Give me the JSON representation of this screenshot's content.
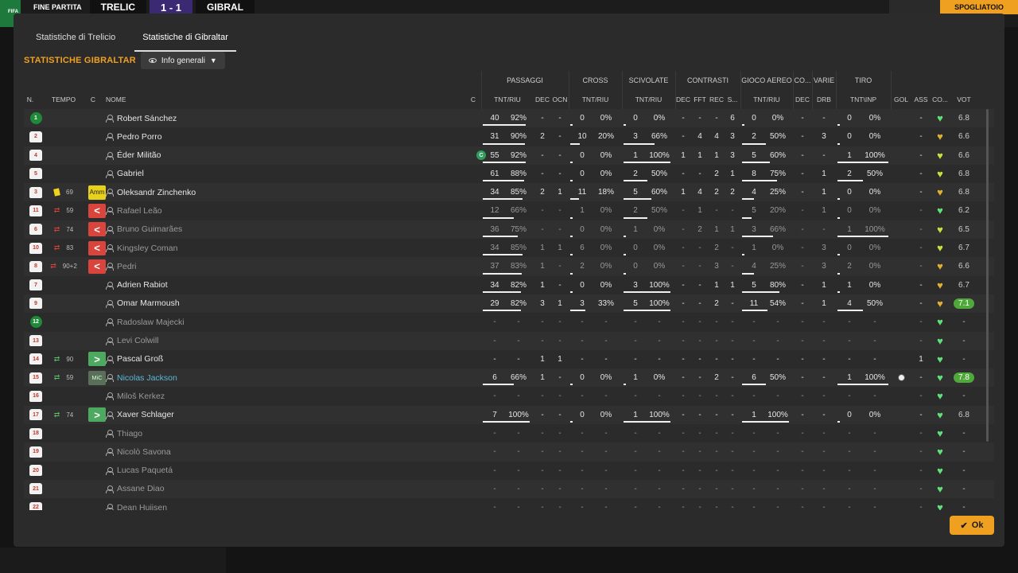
{
  "background": {
    "fifa_label": "FIFA",
    "match_status": "FINE PARTITA",
    "team_home": "TRELIC",
    "score": "1 - 1",
    "team_away": "GIBRAL",
    "right_button": "SPOGLIATOIO"
  },
  "tabs": [
    "Statistiche di Trelicio",
    "Statistiche di Gibraltar"
  ],
  "title": "STATISTICHE GIBRALTAR",
  "dropdown_label": "Info generali",
  "group_headers": {
    "passaggi": "PASSAGGI",
    "cross": "CROSS",
    "scivolate": "SCIVOLATE",
    "contrasti": "CONTRASTI",
    "gioco_aereo": "GIOCO AEREO",
    "co": "CO...",
    "varie": "VARIE",
    "tiro": "TIRO"
  },
  "column_headers": {
    "n": "N.",
    "tempo": "TEMPO",
    "c": "C",
    "nome": "NOME",
    "c2": "C",
    "pass_tnt": "TNT/RIU",
    "pass_dec": "DEC",
    "pass_ocn": "OCN",
    "cross_tnt": "TNT/RIU",
    "sciv_tnt": "TNT/RIU",
    "con_dec": "DEC",
    "con_fft": "FFT",
    "con_rec": "REC",
    "con_s": "S...",
    "aer_tnt": "TNT/RIU",
    "co_dec": "DEC",
    "var_drb": "DRB",
    "tiro_tnt": "TNT\\INP",
    "gol": "GOL",
    "ass": "ASS",
    "co2": "CO...",
    "vot": "VOT"
  },
  "rows": [
    {
      "num": "1",
      "gk": true,
      "minute": "",
      "event": "",
      "badge": "",
      "name": "Robert Sánchez",
      "dim": false,
      "captain": false,
      "pass": [
        "40",
        "92%"
      ],
      "pass_fill": 0.92,
      "pdec": "-",
      "pocn": "-",
      "cross": [
        "0",
        "0%"
      ],
      "cross_fill": 0,
      "sciv": [
        "0",
        "0%"
      ],
      "sciv_fill": 0,
      "cdec": "-",
      "cfft": "-",
      "crec": "-",
      "cs": "6",
      "aer": [
        "0",
        "0%"
      ],
      "aer_fill": 0,
      "codec": "-",
      "drb": "-",
      "tiro": [
        "0",
        "0%"
      ],
      "tiro_fill": 0,
      "gol": "",
      "ass": "-",
      "heart": "green",
      "vot": "6.8",
      "vot_hl": false
    },
    {
      "num": "2",
      "gk": false,
      "minute": "",
      "event": "",
      "badge": "",
      "name": "Pedro Porro",
      "dim": false,
      "captain": false,
      "pass": [
        "31",
        "90%"
      ],
      "pass_fill": 0.9,
      "pdec": "2",
      "pocn": "-",
      "cross": [
        "10",
        "20%"
      ],
      "cross_fill": 0.2,
      "sciv": [
        "3",
        "66%"
      ],
      "sciv_fill": 0.66,
      "cdec": "-",
      "cfft": "4",
      "crec": "4",
      "cs": "3",
      "aer": [
        "2",
        "50%"
      ],
      "aer_fill": 0.5,
      "codec": "-",
      "drb": "3",
      "tiro": [
        "0",
        "0%"
      ],
      "tiro_fill": 0,
      "gol": "",
      "ass": "-",
      "heart": "gold",
      "vot": "6.6",
      "vot_hl": false
    },
    {
      "num": "4",
      "gk": false,
      "minute": "",
      "event": "",
      "badge": "",
      "name": "Éder Militão",
      "dim": false,
      "captain": true,
      "pass": [
        "55",
        "92%"
      ],
      "pass_fill": 0.92,
      "pdec": "-",
      "pocn": "-",
      "cross": [
        "0",
        "0%"
      ],
      "cross_fill": 0,
      "sciv": [
        "1",
        "100%"
      ],
      "sciv_fill": 1,
      "cdec": "1",
      "cfft": "1",
      "crec": "1",
      "cs": "3",
      "aer": [
        "5",
        "60%"
      ],
      "aer_fill": 0.6,
      "codec": "-",
      "drb": "-",
      "tiro": [
        "1",
        "100%"
      ],
      "tiro_fill": 1,
      "gol": "",
      "ass": "-",
      "heart": "lime",
      "vot": "6.6",
      "vot_hl": false
    },
    {
      "num": "5",
      "gk": false,
      "minute": "",
      "event": "",
      "badge": "",
      "name": "Gabriel",
      "dim": false,
      "captain": false,
      "pass": [
        "61",
        "88%"
      ],
      "pass_fill": 0.88,
      "pdec": "-",
      "pocn": "-",
      "cross": [
        "0",
        "0%"
      ],
      "cross_fill": 0,
      "sciv": [
        "2",
        "50%"
      ],
      "sciv_fill": 0.5,
      "cdec": "-",
      "cfft": "-",
      "crec": "2",
      "cs": "1",
      "aer": [
        "8",
        "75%"
      ],
      "aer_fill": 0.75,
      "codec": "-",
      "drb": "1",
      "tiro": [
        "2",
        "50%"
      ],
      "tiro_fill": 0.5,
      "gol": "",
      "ass": "-",
      "heart": "lime",
      "vot": "6.8",
      "vot_hl": false
    },
    {
      "num": "3",
      "gk": false,
      "minute": "69",
      "event": "yellow",
      "badge": "Amm",
      "name": "Oleksandr Zinchenko",
      "dim": false,
      "captain": false,
      "pass": [
        "34",
        "85%"
      ],
      "pass_fill": 0.85,
      "pdec": "2",
      "pocn": "1",
      "cross": [
        "11",
        "18%"
      ],
      "cross_fill": 0.18,
      "sciv": [
        "5",
        "60%"
      ],
      "sciv_fill": 0.6,
      "cdec": "1",
      "cfft": "4",
      "crec": "2",
      "cs": "2",
      "aer": [
        "4",
        "25%"
      ],
      "aer_fill": 0.25,
      "codec": "-",
      "drb": "1",
      "tiro": [
        "0",
        "0%"
      ],
      "tiro_fill": 0,
      "gol": "",
      "ass": "-",
      "heart": "gold",
      "vot": "6.8",
      "vot_hl": false
    },
    {
      "num": "11",
      "gk": false,
      "minute": "59",
      "event": "out",
      "badge": "<",
      "name": "Rafael Leão",
      "dim": true,
      "captain": false,
      "pass": [
        "12",
        "66%"
      ],
      "pass_fill": 0.66,
      "pdec": "-",
      "pocn": "-",
      "cross": [
        "1",
        "0%"
      ],
      "cross_fill": 0,
      "sciv": [
        "2",
        "50%"
      ],
      "sciv_fill": 0.5,
      "cdec": "-",
      "cfft": "1",
      "crec": "-",
      "cs": "-",
      "aer": [
        "5",
        "20%"
      ],
      "aer_fill": 0.2,
      "codec": "-",
      "drb": "1",
      "tiro": [
        "0",
        "0%"
      ],
      "tiro_fill": 0,
      "gol": "",
      "ass": "-",
      "heart": "green",
      "vot": "6.2",
      "vot_hl": false
    },
    {
      "num": "6",
      "gk": false,
      "minute": "74",
      "event": "out",
      "badge": "<",
      "name": "Bruno Guimarães",
      "dim": true,
      "captain": false,
      "pass": [
        "36",
        "75%"
      ],
      "pass_fill": 0.75,
      "pdec": "-",
      "pocn": "-",
      "cross": [
        "0",
        "0%"
      ],
      "cross_fill": 0,
      "sciv": [
        "1",
        "0%"
      ],
      "sciv_fill": 0,
      "cdec": "-",
      "cfft": "2",
      "crec": "1",
      "cs": "1",
      "aer": [
        "3",
        "66%"
      ],
      "aer_fill": 0.66,
      "codec": "-",
      "drb": "-",
      "tiro": [
        "1",
        "100%"
      ],
      "tiro_fill": 1,
      "gol": "",
      "ass": "-",
      "heart": "lime",
      "vot": "6.5",
      "vot_hl": false
    },
    {
      "num": "10",
      "gk": false,
      "minute": "83",
      "event": "out",
      "badge": "<",
      "name": "Kingsley Coman",
      "dim": true,
      "captain": false,
      "pass": [
        "34",
        "85%"
      ],
      "pass_fill": 0.85,
      "pdec": "1",
      "pocn": "1",
      "cross": [
        "6",
        "0%"
      ],
      "cross_fill": 0,
      "sciv": [
        "0",
        "0%"
      ],
      "sciv_fill": 0,
      "cdec": "-",
      "cfft": "-",
      "crec": "2",
      "cs": "-",
      "aer": [
        "1",
        "0%"
      ],
      "aer_fill": 0,
      "codec": "-",
      "drb": "3",
      "tiro": [
        "0",
        "0%"
      ],
      "tiro_fill": 0,
      "gol": "",
      "ass": "-",
      "heart": "lime",
      "vot": "6.7",
      "vot_hl": false
    },
    {
      "num": "8",
      "gk": false,
      "minute": "90+2",
      "event": "out",
      "badge": "<",
      "name": "Pedri",
      "dim": true,
      "captain": false,
      "pass": [
        "37",
        "83%"
      ],
      "pass_fill": 0.83,
      "pdec": "1",
      "pocn": "-",
      "cross": [
        "2",
        "0%"
      ],
      "cross_fill": 0,
      "sciv": [
        "0",
        "0%"
      ],
      "sciv_fill": 0,
      "cdec": "-",
      "cfft": "-",
      "crec": "3",
      "cs": "-",
      "aer": [
        "4",
        "25%"
      ],
      "aer_fill": 0.25,
      "codec": "-",
      "drb": "3",
      "tiro": [
        "2",
        "0%"
      ],
      "tiro_fill": 0,
      "gol": "",
      "ass": "-",
      "heart": "gold",
      "vot": "6.6",
      "vot_hl": false
    },
    {
      "num": "7",
      "gk": false,
      "minute": "",
      "event": "",
      "badge": "",
      "name": "Adrien Rabiot",
      "dim": false,
      "captain": false,
      "pass": [
        "34",
        "82%"
      ],
      "pass_fill": 0.82,
      "pdec": "1",
      "pocn": "-",
      "cross": [
        "0",
        "0%"
      ],
      "cross_fill": 0,
      "sciv": [
        "3",
        "100%"
      ],
      "sciv_fill": 1,
      "cdec": "-",
      "cfft": "-",
      "crec": "1",
      "cs": "1",
      "aer": [
        "5",
        "80%"
      ],
      "aer_fill": 0.8,
      "codec": "-",
      "drb": "1",
      "tiro": [
        "1",
        "0%"
      ],
      "tiro_fill": 0,
      "gol": "",
      "ass": "-",
      "heart": "gold",
      "vot": "6.7",
      "vot_hl": false
    },
    {
      "num": "9",
      "gk": false,
      "minute": "",
      "event": "",
      "badge": "",
      "name": "Omar Marmoush",
      "dim": false,
      "captain": false,
      "pass": [
        "29",
        "82%"
      ],
      "pass_fill": 0.82,
      "pdec": "3",
      "pocn": "1",
      "cross": [
        "3",
        "33%"
      ],
      "cross_fill": 0.33,
      "sciv": [
        "5",
        "100%"
      ],
      "sciv_fill": 1,
      "cdec": "-",
      "cfft": "-",
      "crec": "2",
      "cs": "-",
      "aer": [
        "11",
        "54%"
      ],
      "aer_fill": 0.54,
      "codec": "-",
      "drb": "1",
      "tiro": [
        "4",
        "50%"
      ],
      "tiro_fill": 0.5,
      "gol": "",
      "ass": "-",
      "heart": "gold",
      "vot": "7.1",
      "vot_hl": true
    },
    {
      "num": "12",
      "gk": true,
      "minute": "",
      "event": "",
      "badge": "",
      "name": "Radoslaw Majecki",
      "dim": true,
      "captain": false,
      "pass": [
        "-",
        "-"
      ],
      "pass_fill": 0,
      "pdec": "-",
      "pocn": "-",
      "cross": [
        "-",
        "-"
      ],
      "cross_fill": 0,
      "sciv": [
        "-",
        "-"
      ],
      "sciv_fill": 0,
      "cdec": "-",
      "cfft": "-",
      "crec": "-",
      "cs": "-",
      "aer": [
        "-",
        "-"
      ],
      "aer_fill": 0,
      "codec": "-",
      "drb": "-",
      "tiro": [
        "-",
        "-"
      ],
      "tiro_fill": 0,
      "gol": "",
      "ass": "-",
      "heart": "green",
      "vot": "-",
      "vot_hl": false
    },
    {
      "num": "13",
      "gk": false,
      "minute": "",
      "event": "",
      "badge": "",
      "name": "Levi Colwill",
      "dim": true,
      "captain": false,
      "pass": [
        "-",
        "-"
      ],
      "pass_fill": 0,
      "pdec": "-",
      "pocn": "-",
      "cross": [
        "-",
        "-"
      ],
      "cross_fill": 0,
      "sciv": [
        "-",
        "-"
      ],
      "sciv_fill": 0,
      "cdec": "-",
      "cfft": "-",
      "crec": "-",
      "cs": "-",
      "aer": [
        "-",
        "-"
      ],
      "aer_fill": 0,
      "codec": "-",
      "drb": "-",
      "tiro": [
        "-",
        "-"
      ],
      "tiro_fill": 0,
      "gol": "",
      "ass": "-",
      "heart": "green",
      "vot": "-",
      "vot_hl": false
    },
    {
      "num": "14",
      "gk": false,
      "minute": "90",
      "event": "in",
      "badge": ">",
      "name": "Pascal Groß",
      "dim": false,
      "captain": false,
      "pass": [
        "-",
        "-"
      ],
      "pass_fill": 0,
      "pdec": "1",
      "pocn": "1",
      "cross": [
        "-",
        "-"
      ],
      "cross_fill": 0,
      "sciv": [
        "-",
        "-"
      ],
      "sciv_fill": 0,
      "cdec": "-",
      "cfft": "-",
      "crec": "-",
      "cs": "-",
      "aer": [
        "-",
        "-"
      ],
      "aer_fill": 0,
      "codec": "-",
      "drb": "-",
      "tiro": [
        "-",
        "-"
      ],
      "tiro_fill": 0,
      "gol": "",
      "ass": "1",
      "heart": "green",
      "vot": "-",
      "vot_hl": false
    },
    {
      "num": "15",
      "gk": false,
      "minute": "59",
      "event": "in",
      "badge": "MiC",
      "name": "Nicolas Jackson",
      "dim": false,
      "link": true,
      "captain": false,
      "pass": [
        "6",
        "66%"
      ],
      "pass_fill": 0.66,
      "pdec": "1",
      "pocn": "-",
      "cross": [
        "0",
        "0%"
      ],
      "cross_fill": 0,
      "sciv": [
        "1",
        "0%"
      ],
      "sciv_fill": 0,
      "cdec": "-",
      "cfft": "-",
      "crec": "2",
      "cs": "-",
      "aer": [
        "6",
        "50%"
      ],
      "aer_fill": 0.5,
      "codec": "-",
      "drb": "-",
      "tiro": [
        "1",
        "100%"
      ],
      "tiro_fill": 1,
      "gol": "ball",
      "ass": "-",
      "heart": "green",
      "vot": "7.8",
      "vot_hl": true
    },
    {
      "num": "16",
      "gk": false,
      "minute": "",
      "event": "",
      "badge": "",
      "name": "Miloš Kerkez",
      "dim": true,
      "captain": false,
      "pass": [
        "-",
        "-"
      ],
      "pass_fill": 0,
      "pdec": "-",
      "pocn": "-",
      "cross": [
        "-",
        "-"
      ],
      "cross_fill": 0,
      "sciv": [
        "-",
        "-"
      ],
      "sciv_fill": 0,
      "cdec": "-",
      "cfft": "-",
      "crec": "-",
      "cs": "-",
      "aer": [
        "-",
        "-"
      ],
      "aer_fill": 0,
      "codec": "-",
      "drb": "-",
      "tiro": [
        "-",
        "-"
      ],
      "tiro_fill": 0,
      "gol": "",
      "ass": "-",
      "heart": "green",
      "vot": "-",
      "vot_hl": false
    },
    {
      "num": "17",
      "gk": false,
      "minute": "74",
      "event": "in",
      "badge": ">",
      "name": "Xaver Schlager",
      "dim": false,
      "captain": false,
      "pass": [
        "7",
        "100%"
      ],
      "pass_fill": 1,
      "pdec": "-",
      "pocn": "-",
      "cross": [
        "0",
        "0%"
      ],
      "cross_fill": 0,
      "sciv": [
        "1",
        "100%"
      ],
      "sciv_fill": 1,
      "cdec": "-",
      "cfft": "-",
      "crec": "-",
      "cs": "-",
      "aer": [
        "1",
        "100%"
      ],
      "aer_fill": 1,
      "codec": "-",
      "drb": "-",
      "tiro": [
        "0",
        "0%"
      ],
      "tiro_fill": 0,
      "gol": "",
      "ass": "-",
      "heart": "green",
      "vot": "6.8",
      "vot_hl": false
    },
    {
      "num": "18",
      "gk": false,
      "minute": "",
      "event": "",
      "badge": "",
      "name": "Thiago",
      "dim": true,
      "captain": false,
      "pass": [
        "-",
        "-"
      ],
      "pass_fill": 0,
      "pdec": "-",
      "pocn": "-",
      "cross": [
        "-",
        "-"
      ],
      "cross_fill": 0,
      "sciv": [
        "-",
        "-"
      ],
      "sciv_fill": 0,
      "cdec": "-",
      "cfft": "-",
      "crec": "-",
      "cs": "-",
      "aer": [
        "-",
        "-"
      ],
      "aer_fill": 0,
      "codec": "-",
      "drb": "-",
      "tiro": [
        "-",
        "-"
      ],
      "tiro_fill": 0,
      "gol": "",
      "ass": "-",
      "heart": "green",
      "vot": "-",
      "vot_hl": false
    },
    {
      "num": "19",
      "gk": false,
      "minute": "",
      "event": "",
      "badge": "",
      "name": "Nicolò Savona",
      "dim": true,
      "captain": false,
      "pass": [
        "-",
        "-"
      ],
      "pass_fill": 0,
      "pdec": "-",
      "pocn": "-",
      "cross": [
        "-",
        "-"
      ],
      "cross_fill": 0,
      "sciv": [
        "-",
        "-"
      ],
      "sciv_fill": 0,
      "cdec": "-",
      "cfft": "-",
      "crec": "-",
      "cs": "-",
      "aer": [
        "-",
        "-"
      ],
      "aer_fill": 0,
      "codec": "-",
      "drb": "-",
      "tiro": [
        "-",
        "-"
      ],
      "tiro_fill": 0,
      "gol": "",
      "ass": "-",
      "heart": "green",
      "vot": "-",
      "vot_hl": false
    },
    {
      "num": "20",
      "gk": false,
      "minute": "",
      "event": "",
      "badge": "",
      "name": "Lucas Paquetá",
      "dim": true,
      "captain": false,
      "pass": [
        "-",
        "-"
      ],
      "pass_fill": 0,
      "pdec": "-",
      "pocn": "-",
      "cross": [
        "-",
        "-"
      ],
      "cross_fill": 0,
      "sciv": [
        "-",
        "-"
      ],
      "sciv_fill": 0,
      "cdec": "-",
      "cfft": "-",
      "crec": "-",
      "cs": "-",
      "aer": [
        "-",
        "-"
      ],
      "aer_fill": 0,
      "codec": "-",
      "drb": "-",
      "tiro": [
        "-",
        "-"
      ],
      "tiro_fill": 0,
      "gol": "",
      "ass": "-",
      "heart": "green",
      "vot": "-",
      "vot_hl": false
    },
    {
      "num": "21",
      "gk": false,
      "minute": "",
      "event": "",
      "badge": "",
      "name": "Assane Diao",
      "dim": true,
      "captain": false,
      "pass": [
        "-",
        "-"
      ],
      "pass_fill": 0,
      "pdec": "-",
      "pocn": "-",
      "cross": [
        "-",
        "-"
      ],
      "cross_fill": 0,
      "sciv": [
        "-",
        "-"
      ],
      "sciv_fill": 0,
      "cdec": "-",
      "cfft": "-",
      "crec": "-",
      "cs": "-",
      "aer": [
        "-",
        "-"
      ],
      "aer_fill": 0,
      "codec": "-",
      "drb": "-",
      "tiro": [
        "-",
        "-"
      ],
      "tiro_fill": 0,
      "gol": "",
      "ass": "-",
      "heart": "green",
      "vot": "-",
      "vot_hl": false
    },
    {
      "num": "22",
      "gk": false,
      "minute": "",
      "event": "",
      "badge": "",
      "name": "Dean Huijsen",
      "dim": true,
      "captain": false,
      "pass": [
        "-",
        "-"
      ],
      "pass_fill": 0,
      "pdec": "-",
      "pocn": "-",
      "cross": [
        "-",
        "-"
      ],
      "cross_fill": 0,
      "sciv": [
        "-",
        "-"
      ],
      "sciv_fill": 0,
      "cdec": "-",
      "cfft": "-",
      "crec": "-",
      "cs": "-",
      "aer": [
        "-",
        "-"
      ],
      "aer_fill": 0,
      "codec": "-",
      "drb": "-",
      "tiro": [
        "-",
        "-"
      ],
      "tiro_fill": 0,
      "gol": "",
      "ass": "-",
      "heart": "green",
      "vot": "-",
      "vot_hl": false
    }
  ],
  "captain_label": "C",
  "ok_label": "Ok",
  "colors": {
    "accent": "#f0a020",
    "heart_green": "#5fe07a",
    "heart_gold": "#e0b030",
    "heart_lime": "#c8e040",
    "rating_highlight": "#4fa83a"
  }
}
